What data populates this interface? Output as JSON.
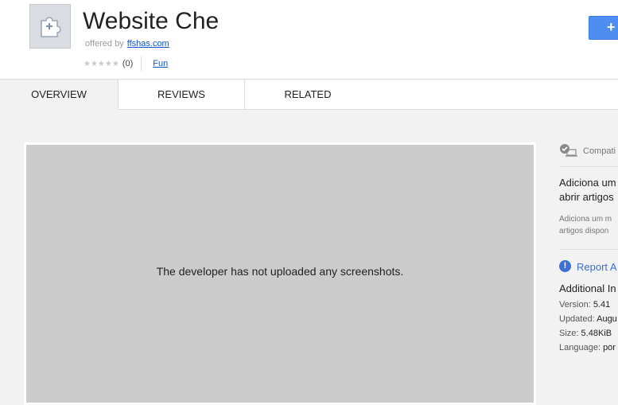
{
  "header": {
    "title": "Website Che",
    "offered_by_label": "offered by",
    "offered_by_link": "ffshas.com",
    "stars": "★★★★★",
    "rating_count": "(0)",
    "category": "Fun",
    "add_button_label": "+"
  },
  "tabs": [
    {
      "label": "OVERVIEW",
      "active": true
    },
    {
      "label": "REVIEWS",
      "active": false
    },
    {
      "label": "RELATED",
      "active": false
    }
  ],
  "main": {
    "no_screenshots_text": "The developer has not uploaded any screenshots."
  },
  "sidebar": {
    "compat_text": "Compati",
    "desc_bold_line1": "Adiciona um",
    "desc_bold_line2": "abrir artigos",
    "desc_small_line1": "Adiciona um m",
    "desc_small_line2": "artigos dispon",
    "report_text": "Report A",
    "additional_title": "Additional In",
    "info": [
      {
        "label": "Version:",
        "value": "5.41"
      },
      {
        "label": "Updated:",
        "value": "Augu"
      },
      {
        "label": "Size:",
        "value": "5.48KiB"
      },
      {
        "label": "Language:",
        "value": "por"
      }
    ]
  },
  "colors": {
    "accent": "#4d8ef0",
    "link": "#1155cc",
    "report": "#3d6fd6",
    "screenshot_bg": "#cccccc"
  }
}
